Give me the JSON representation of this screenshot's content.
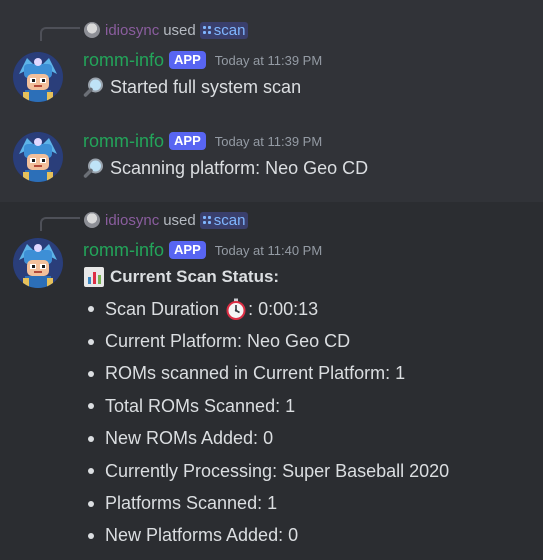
{
  "messages": [
    {
      "reply": {
        "user": "idiosync",
        "used": "used",
        "command": "scan"
      },
      "author": "romm-info",
      "badge": "APP",
      "timestamp": "Today at 11:39 PM",
      "emoji": "magnifying-glass",
      "text": "Started full system scan"
    },
    {
      "author": "romm-info",
      "badge": "APP",
      "timestamp": "Today at 11:39 PM",
      "emoji": "magnifying-glass",
      "text": "Scanning platform: Neo Geo CD"
    },
    {
      "reply": {
        "user": "idiosync",
        "used": "used",
        "command": "scan"
      },
      "author": "romm-info",
      "badge": "APP",
      "timestamp": "Today at 11:40 PM",
      "emoji": "bar-chart",
      "title": "Current Scan Status:",
      "items": [
        {
          "label": "Scan Duration",
          "emoji": "stopwatch",
          "value": ": 0:00:13"
        },
        {
          "text": "Current Platform: Neo Geo CD"
        },
        {
          "text": "ROMs scanned in Current Platform: 1"
        },
        {
          "text": "Total ROMs Scanned: 1"
        },
        {
          "text": "New ROMs Added: 0"
        },
        {
          "text": "Currently Processing: Super Baseball 2020"
        },
        {
          "text": "Platforms Scanned: 1"
        },
        {
          "text": "New Platforms Added: 0"
        }
      ]
    }
  ],
  "colors": {
    "background": "#313338",
    "highlight_background": "#2b2d31",
    "username": "#23a55a",
    "app_badge": "#5865f2",
    "timestamp": "#949ba4",
    "reply_user": "#8a5d9e",
    "command": "#7fb6ff"
  }
}
